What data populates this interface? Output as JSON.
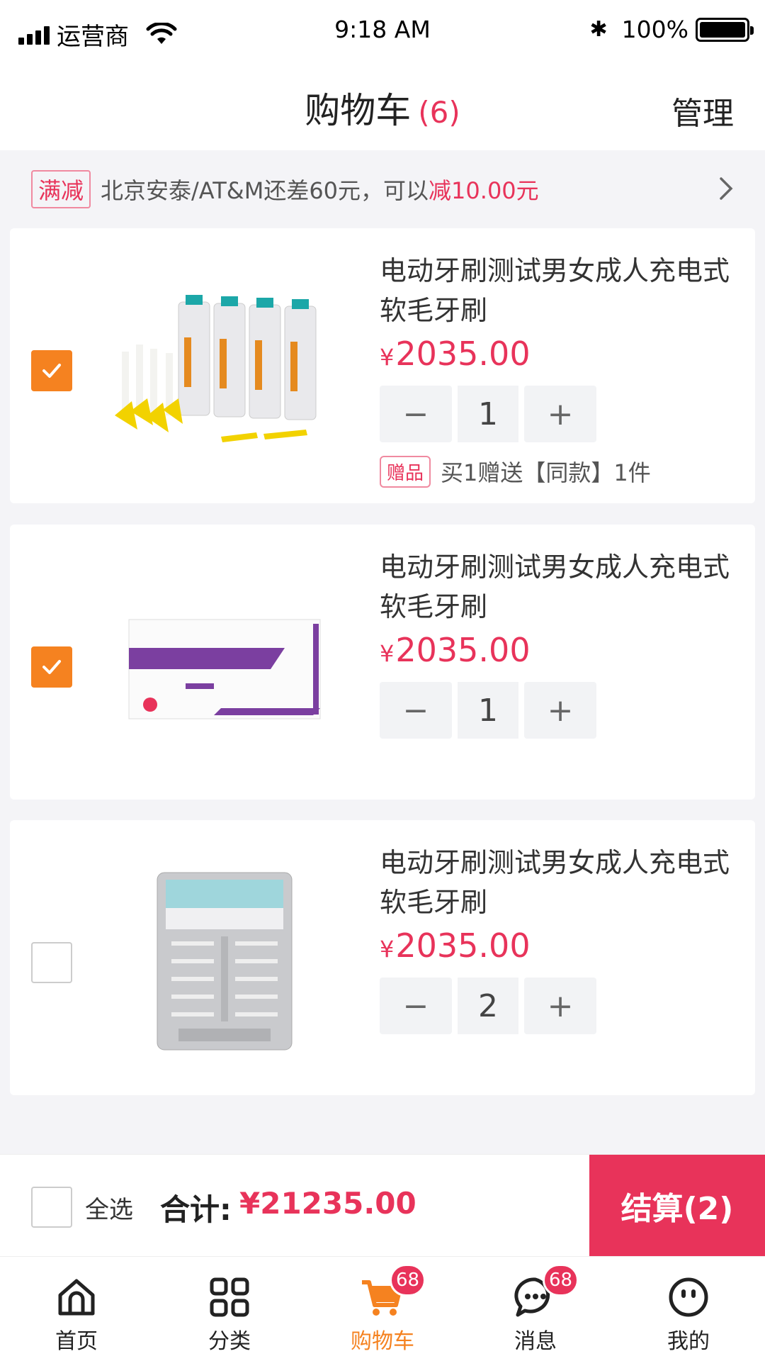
{
  "status_bar": {
    "carrier": "运营商",
    "time": "9:18 AM",
    "battery_percent": "100%"
  },
  "header": {
    "title": "购物车",
    "count": "(6)",
    "manage_label": "管理"
  },
  "promo": {
    "tag": "满减",
    "text": "北京安泰/AT&M还差60元，可以",
    "highlight": "减10.00元"
  },
  "cart_items": [
    {
      "name": "电动牙刷测试男女成人充电式软毛牙刷",
      "currency": "¥",
      "price": "2035.00",
      "quantity": "1",
      "checked": true,
      "gift_tag": "赠品",
      "gift_text": "买1赠送【同款】1件"
    },
    {
      "name": "电动牙刷测试男女成人充电式软毛牙刷",
      "currency": "¥",
      "price": "2035.00",
      "quantity": "1",
      "checked": true
    },
    {
      "name": "电动牙刷测试男女成人充电式软毛牙刷",
      "currency": "¥",
      "price": "2035.00",
      "quantity": "2",
      "checked": false
    }
  ],
  "stepper": {
    "minus": "−",
    "plus": "+"
  },
  "checkout": {
    "select_all_label": "全选",
    "total_label": "合计:",
    "total_value": "¥21235.00",
    "button_label": "结算(2)"
  },
  "tabs": [
    {
      "label": "首页",
      "icon": "home-icon"
    },
    {
      "label": "分类",
      "icon": "category-icon"
    },
    {
      "label": "购物车",
      "icon": "cart-icon",
      "badge": "68",
      "active": true
    },
    {
      "label": "消息",
      "icon": "message-icon",
      "badge": "68"
    },
    {
      "label": "我的",
      "icon": "profile-icon"
    }
  ],
  "colors": {
    "accent_red": "#e8335a",
    "accent_orange": "#f58220"
  }
}
